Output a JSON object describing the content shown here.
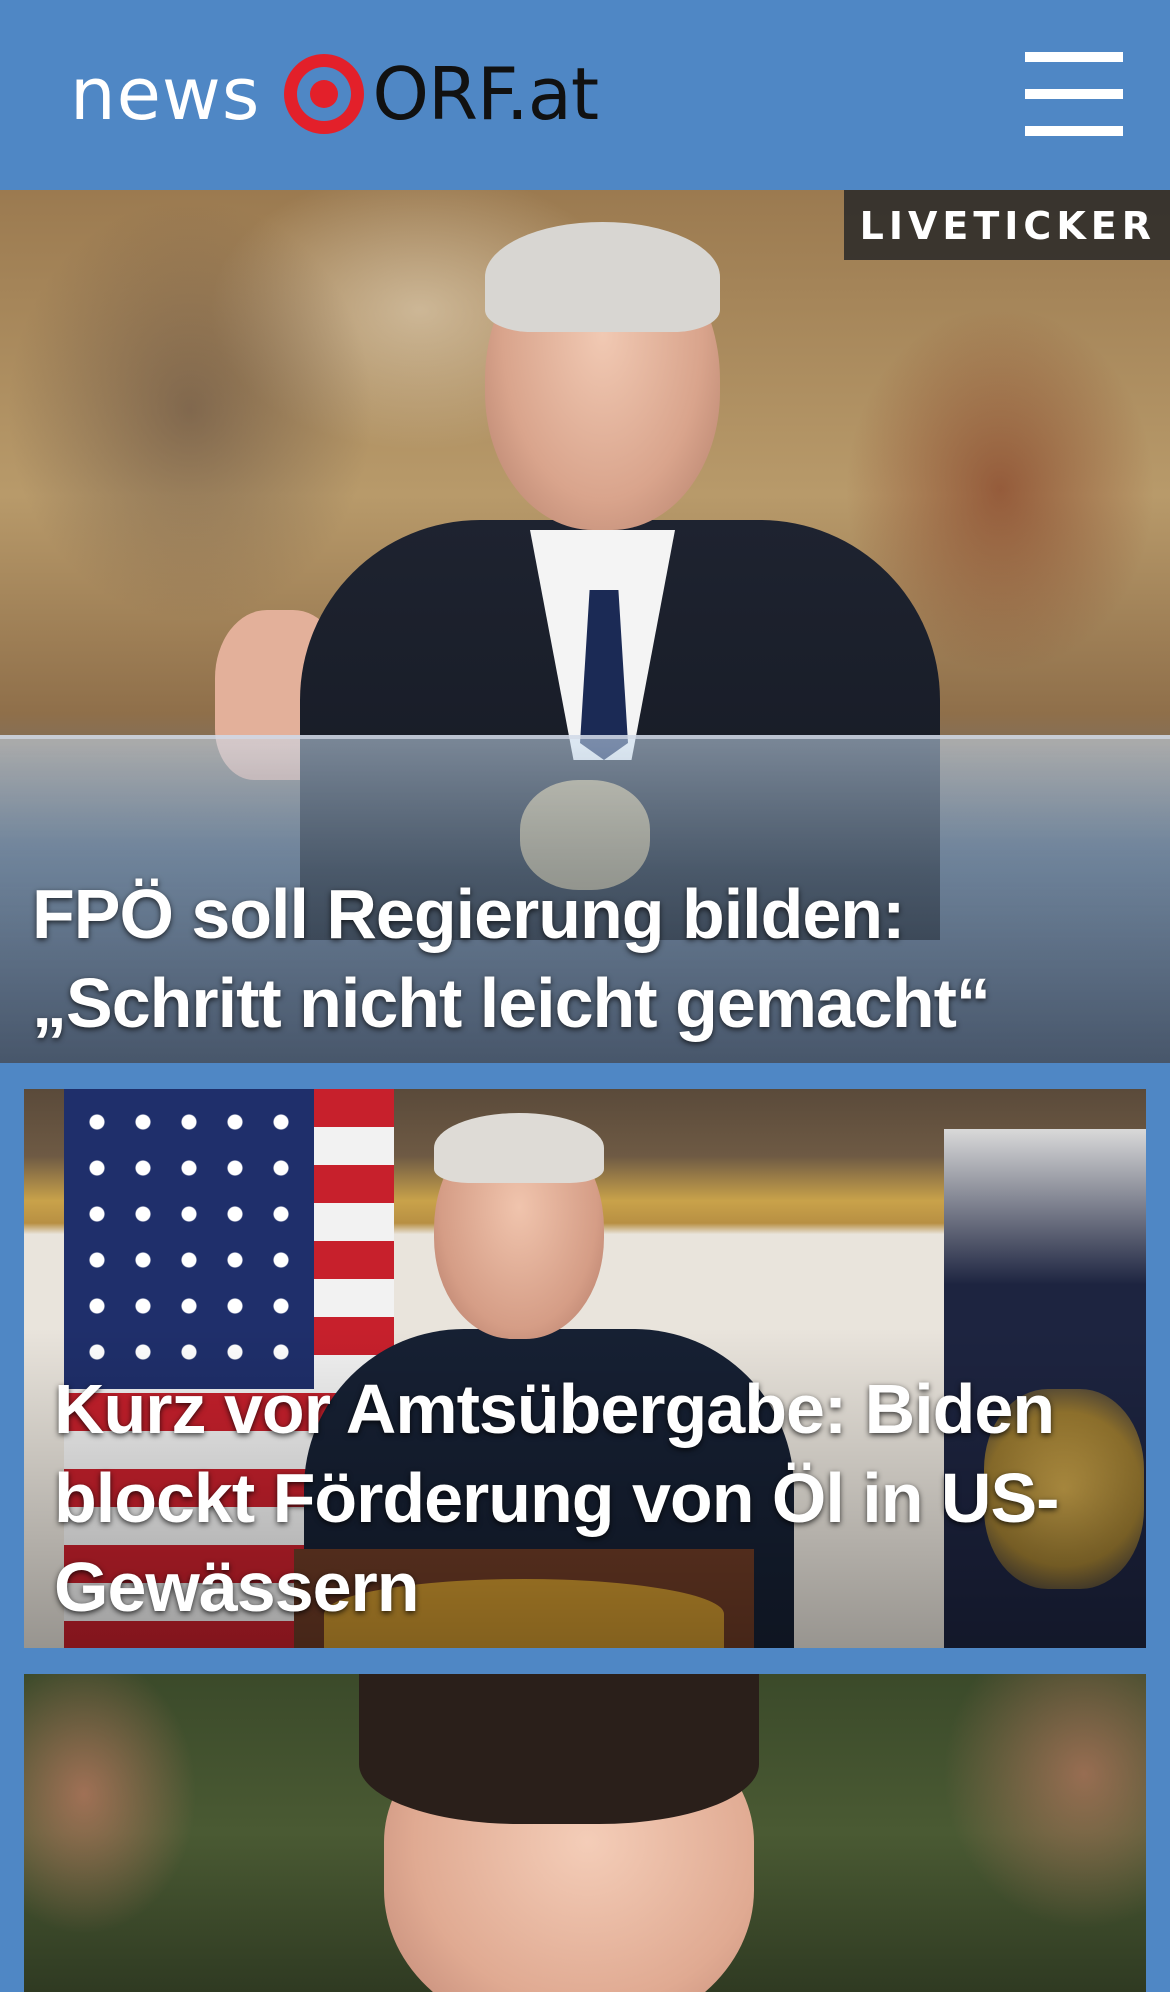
{
  "header": {
    "logo_news": "news",
    "logo_orf": "ORF.at",
    "menu_icon": "hamburger-menu-icon"
  },
  "colors": {
    "background": "#4f87c5",
    "logo_red": "#e3202a",
    "badge_bg": "#2a2a2a",
    "headline_text": "#ffffff"
  },
  "stories": [
    {
      "badge": "LIVETICKER",
      "headline": "FPÖ soll Regierung bilden: „Schritt nicht leicht gemacht“"
    },
    {
      "headline": "Kurz vor Amtsübergabe: Biden blockt Förderung von Öl in US-Gewässern"
    },
    {
      "headline": ""
    }
  ]
}
